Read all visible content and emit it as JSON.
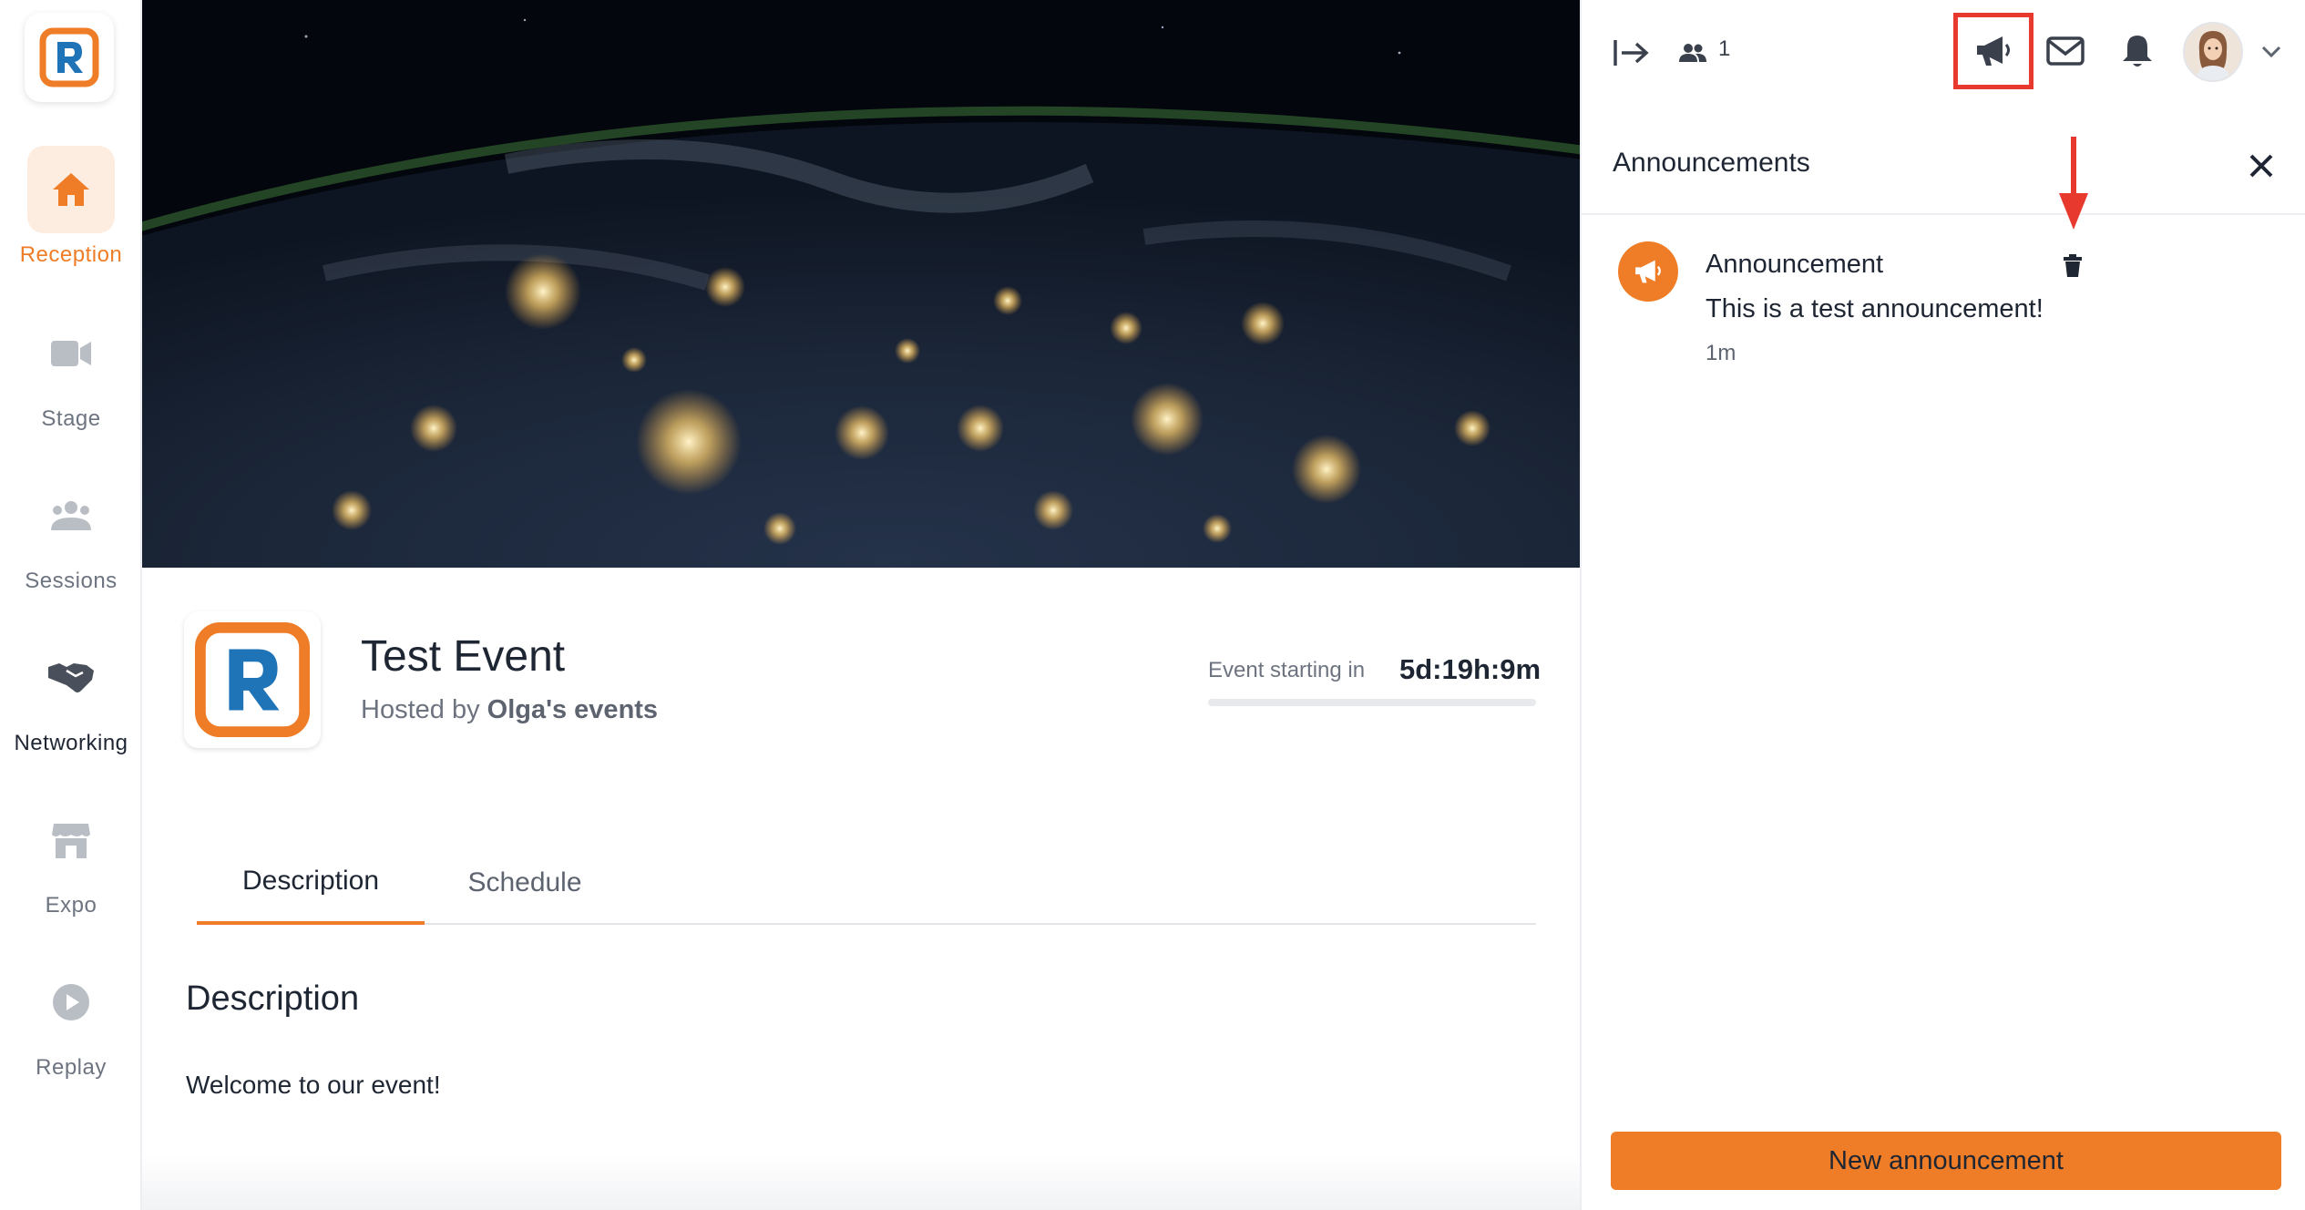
{
  "sidebar": {
    "logo_icon": "r-brand-logo",
    "items": [
      {
        "label": "Reception",
        "icon": "home-icon",
        "active": true
      },
      {
        "label": "Stage",
        "icon": "video-camera-icon"
      },
      {
        "label": "Sessions",
        "icon": "group-icon"
      },
      {
        "label": "Networking",
        "icon": "handshake-icon"
      },
      {
        "label": "Expo",
        "icon": "storefront-icon"
      },
      {
        "label": "Replay",
        "icon": "play-circle-icon"
      }
    ]
  },
  "event": {
    "title": "Test Event",
    "hosted_by_prefix": "Hosted by",
    "host_name": "Olga's events",
    "countdown_label": "Event starting in",
    "countdown_value": "5d:19h:9m"
  },
  "tabs": [
    {
      "label": "Description",
      "active": true
    },
    {
      "label": "Schedule",
      "active": false
    }
  ],
  "description": {
    "heading": "Description",
    "body": "Welcome to our event!"
  },
  "topbar": {
    "attendee_count": "1",
    "icons": [
      "exit-panel-icon",
      "people-icon",
      "megaphone-icon",
      "mail-icon",
      "bell-icon",
      "user-avatar",
      "chevron-down-icon"
    ]
  },
  "announcements": {
    "title": "Announcements",
    "items": [
      {
        "title": "Announcement",
        "text": "This is a test announcement!",
        "time": "1m"
      }
    ],
    "new_button_label": "New announcement"
  },
  "colors": {
    "accent": "#ef7d27",
    "accent_light": "#fdece0",
    "highlight_red": "#e8392e",
    "brand_blue": "#1f73b7"
  }
}
